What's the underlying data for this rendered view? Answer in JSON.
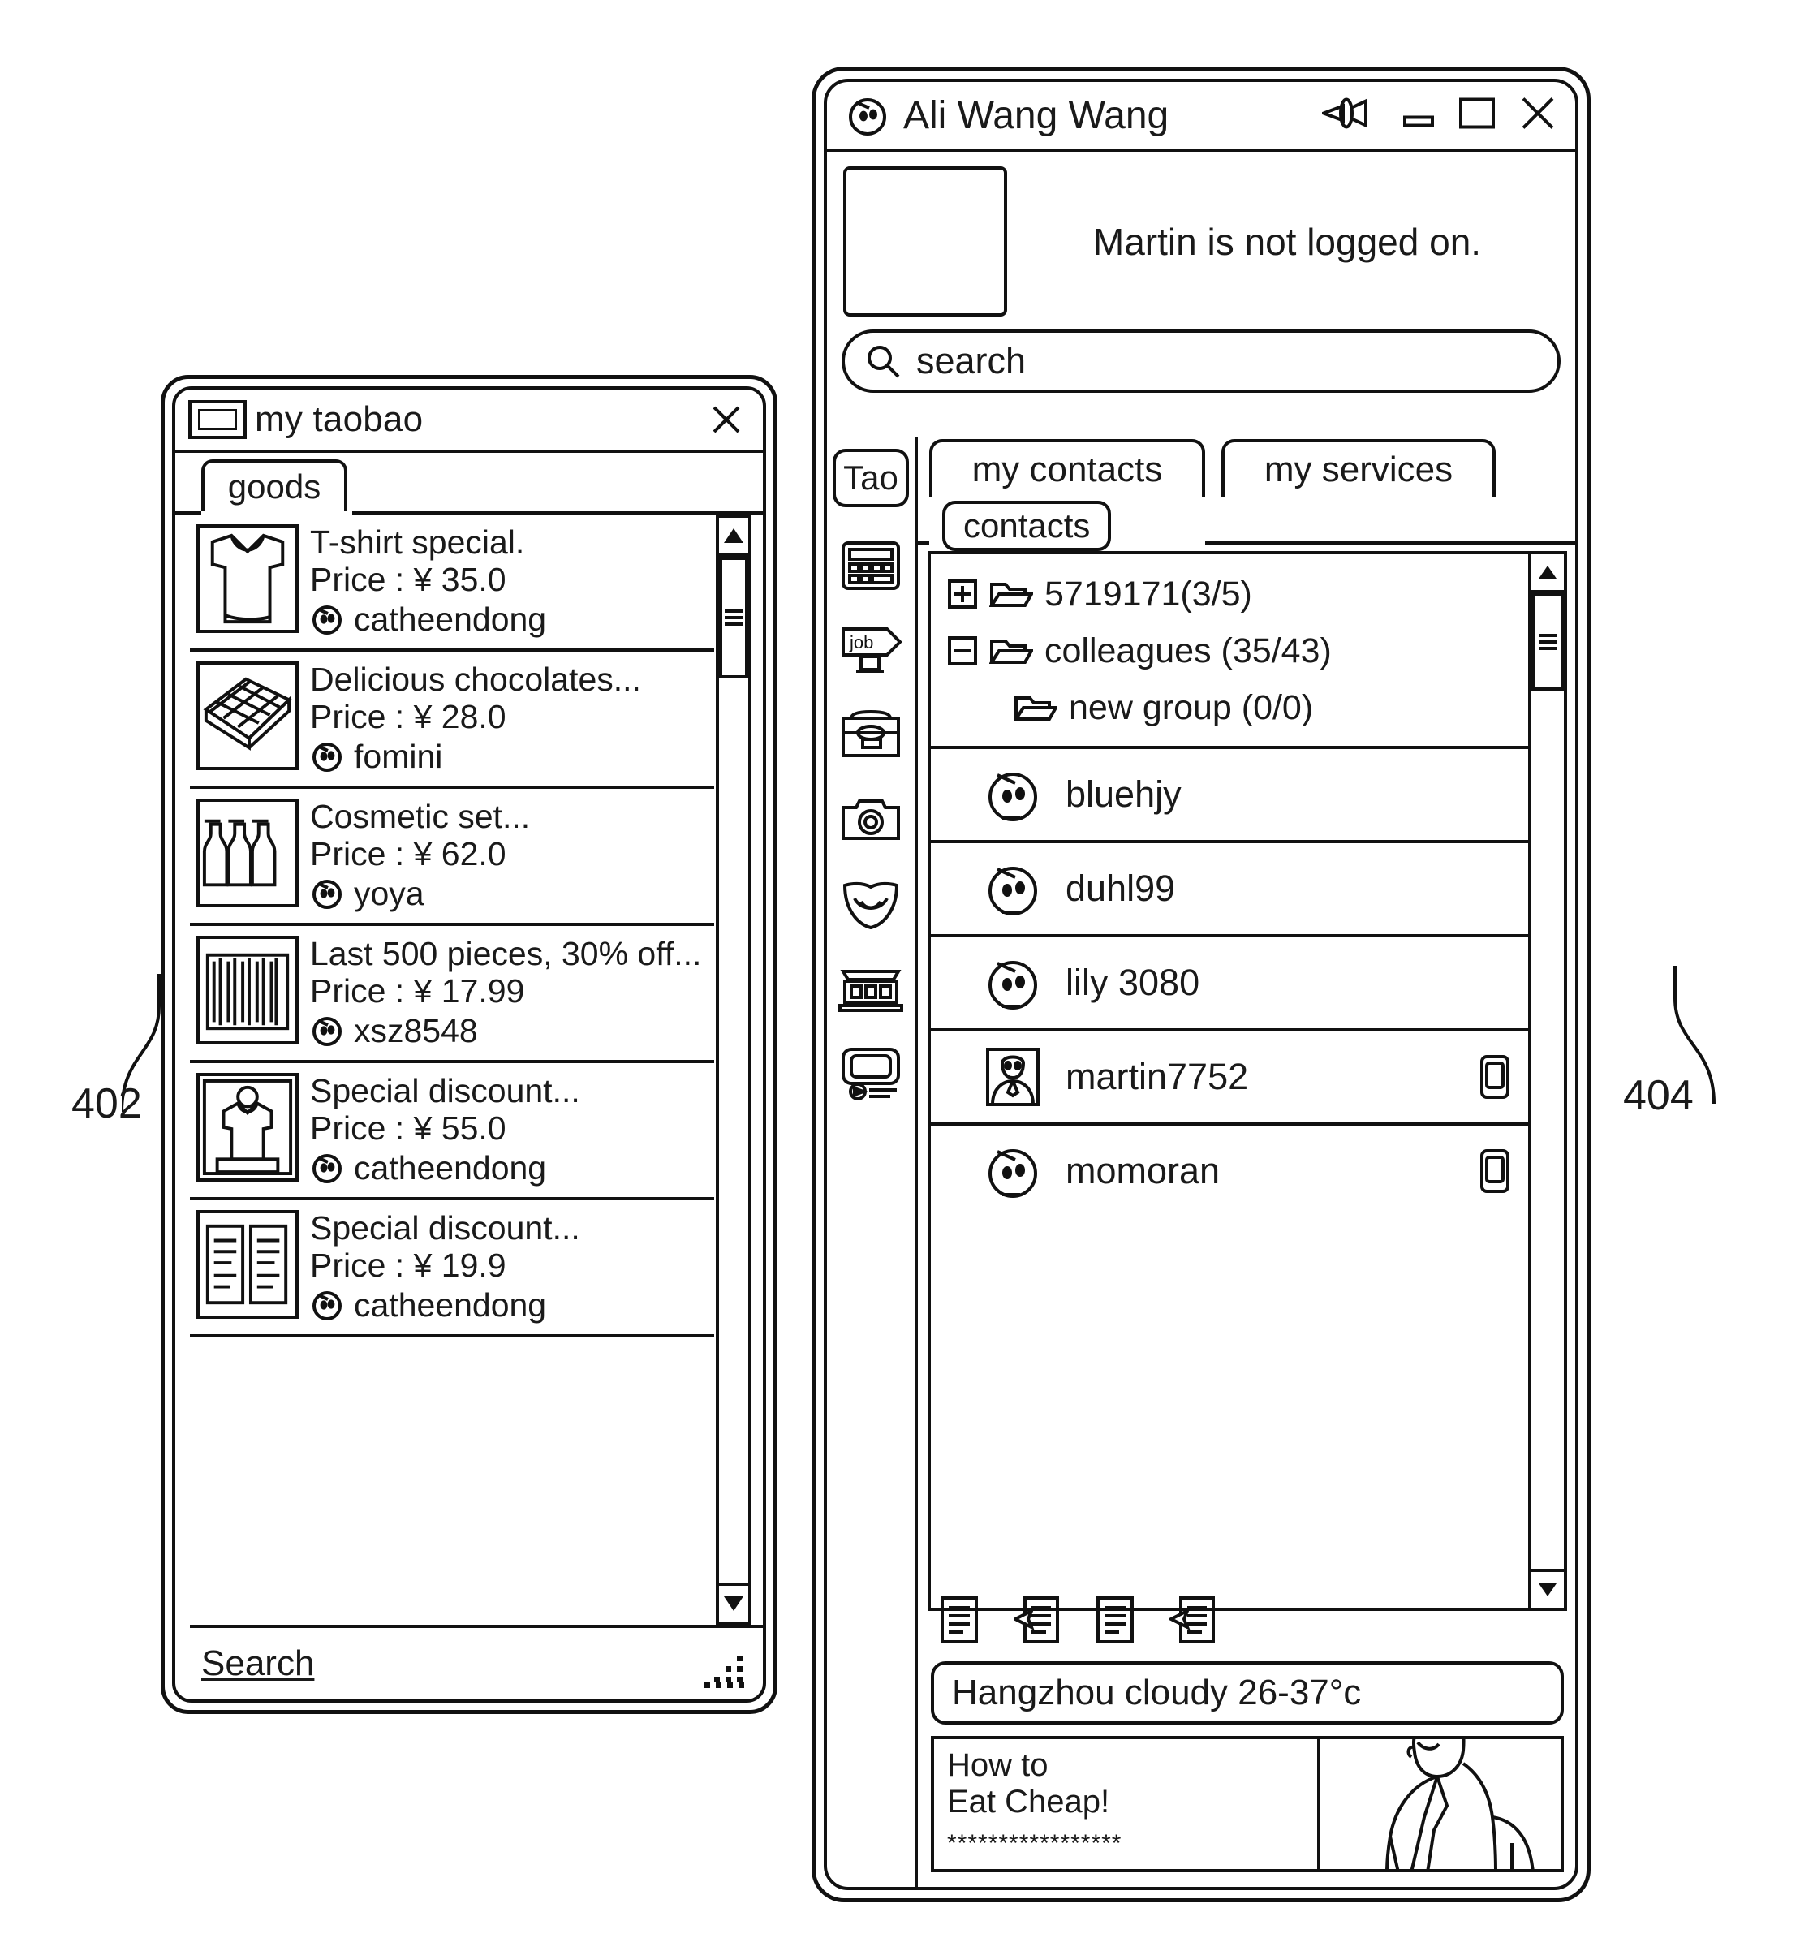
{
  "taobao_window": {
    "title": "my taobao",
    "app_icon": "window-icon",
    "close_icon": "close-icon",
    "tab": "goods",
    "items": [
      {
        "name": "T-shirt special.",
        "price": "Price : ¥ 35.0",
        "seller": "catheendong",
        "thumb": "tshirt"
      },
      {
        "name": "Delicious chocolates...",
        "price": "Price : ¥ 28.0",
        "seller": "fomini",
        "thumb": "chocolate"
      },
      {
        "name": "Cosmetic set...",
        "price": "Price : ¥ 62.0",
        "seller": "yoya",
        "thumb": "cosmetics"
      },
      {
        "name": "Last 500 pieces, 30% off...",
        "price": "Price : ¥ 17.99",
        "seller": "xsz8548",
        "thumb": "books"
      },
      {
        "name": "Special discount...",
        "price": "Price : ¥ 55.0",
        "seller": "catheendong",
        "thumb": "shirt-photo"
      },
      {
        "name": "Special discount...",
        "price": "Price : ¥ 19.9",
        "seller": "catheendong",
        "thumb": "documents"
      }
    ],
    "footer_link": "Search"
  },
  "aliww_window": {
    "title": "Ali Wang Wang",
    "titlebar_icons": [
      "pin-icon",
      "minimize-icon",
      "maximize-icon",
      "close-icon"
    ],
    "status_text": "Martin is not logged on.",
    "search": {
      "placeholder": "search",
      "icon": "search-icon"
    },
    "rail": {
      "tao_label": "Tao",
      "icons": [
        "calculator-icon",
        "job-signpost-icon",
        "briefcase-icon",
        "camera-icon",
        "shield-leaf-icon",
        "shop-icon",
        "media-player-icon"
      ]
    },
    "tabs": [
      {
        "label": "my contacts",
        "active": true
      },
      {
        "label": "my services",
        "active": false
      }
    ],
    "subtab": "contacts",
    "groups": [
      {
        "label": "5719171(3/5)",
        "state": "collapsed",
        "expander": "plus-icon",
        "indent": 0
      },
      {
        "label": "colleagues (35/43)",
        "state": "expanded",
        "expander": "minus-icon",
        "indent": 0
      },
      {
        "label": "new group (0/0)",
        "state": "leaf",
        "expander": "none",
        "indent": 1
      }
    ],
    "contacts": [
      {
        "name": "bluehjy",
        "avatar": "ww-face",
        "mobile": false
      },
      {
        "name": "duhl99",
        "avatar": "ww-face",
        "mobile": false
      },
      {
        "name": "lily 3080",
        "avatar": "ww-face",
        "mobile": false
      },
      {
        "name": "martin7752",
        "avatar": "photo-portrait",
        "mobile": true
      },
      {
        "name": "momoran",
        "avatar": "ww-face",
        "mobile": true
      }
    ],
    "toolbar_icons": [
      "message-icon",
      "message-send-icon",
      "message-icon",
      "message-send-icon"
    ],
    "weather": "Hangzhou cloudy 26-37°c",
    "ad": {
      "line1": "How to",
      "line2": "Eat Cheap!",
      "stars1": "*****************",
      "stars2": "*********************",
      "image": "woman-illustration"
    }
  },
  "callouts": {
    "left": "402",
    "right": "404"
  }
}
